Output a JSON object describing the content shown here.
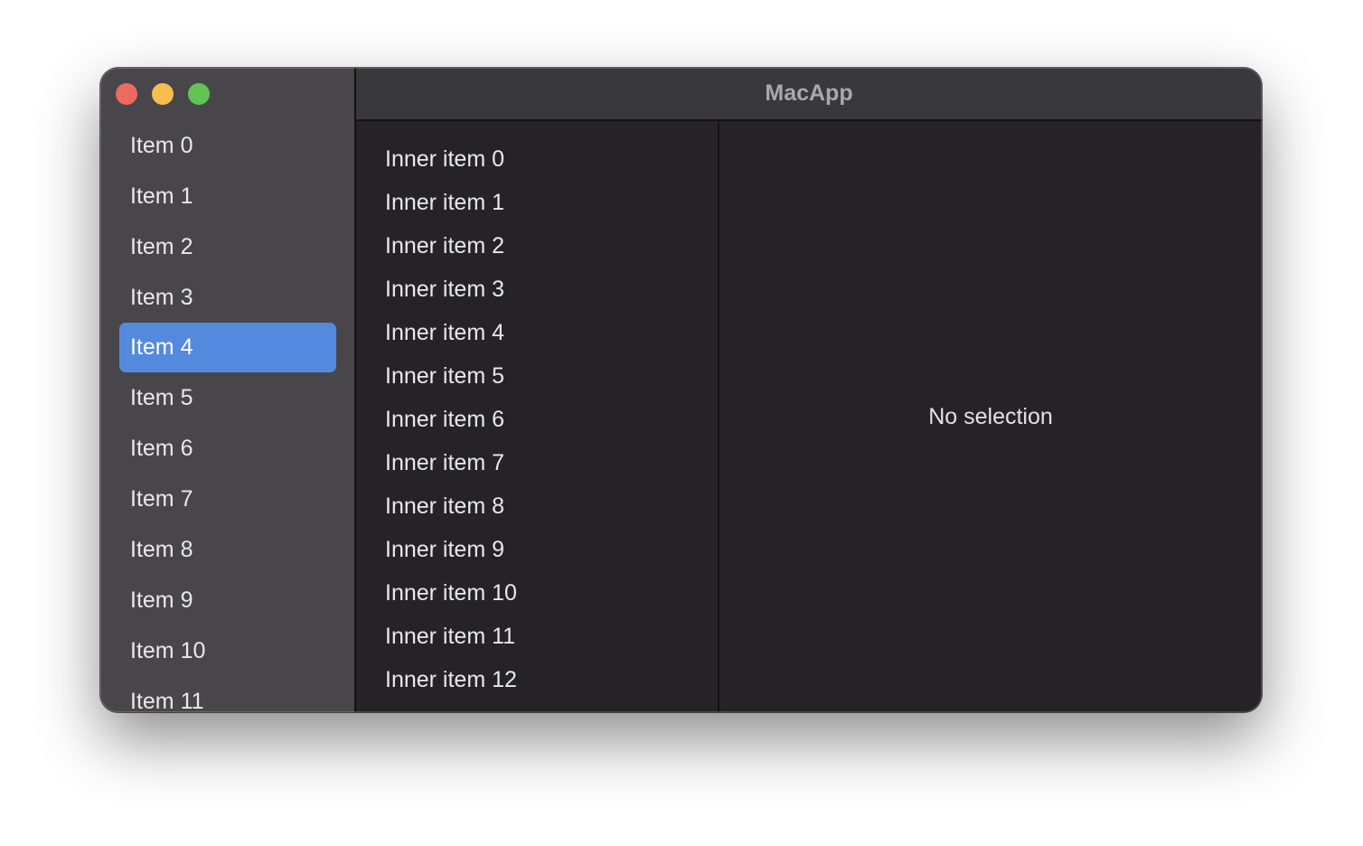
{
  "window": {
    "title": "MacApp",
    "traffic_lights": [
      "close",
      "minimize",
      "zoom"
    ]
  },
  "sidebar": {
    "selected_index": 4,
    "items": [
      {
        "label": "Item 0"
      },
      {
        "label": "Item 1"
      },
      {
        "label": "Item 2"
      },
      {
        "label": "Item 3"
      },
      {
        "label": "Item 4"
      },
      {
        "label": "Item 5"
      },
      {
        "label": "Item 6"
      },
      {
        "label": "Item 7"
      },
      {
        "label": "Item 8"
      },
      {
        "label": "Item 9"
      },
      {
        "label": "Item 10"
      },
      {
        "label": "Item 11"
      }
    ]
  },
  "content": {
    "items": [
      {
        "label": "Inner item 0"
      },
      {
        "label": "Inner item 1"
      },
      {
        "label": "Inner item 2"
      },
      {
        "label": "Inner item 3"
      },
      {
        "label": "Inner item 4"
      },
      {
        "label": "Inner item 5"
      },
      {
        "label": "Inner item 6"
      },
      {
        "label": "Inner item 7"
      },
      {
        "label": "Inner item 8"
      },
      {
        "label": "Inner item 9"
      },
      {
        "label": "Inner item 10"
      },
      {
        "label": "Inner item 11"
      },
      {
        "label": "Inner item 12"
      }
    ]
  },
  "detail": {
    "placeholder": "No selection"
  },
  "colors": {
    "selection": "#538ade",
    "sidebar_bg": "#48464a",
    "content_bg": "#252327",
    "close": "#ec6a5e",
    "minimize": "#f4bf4f",
    "zoom": "#61c554"
  }
}
